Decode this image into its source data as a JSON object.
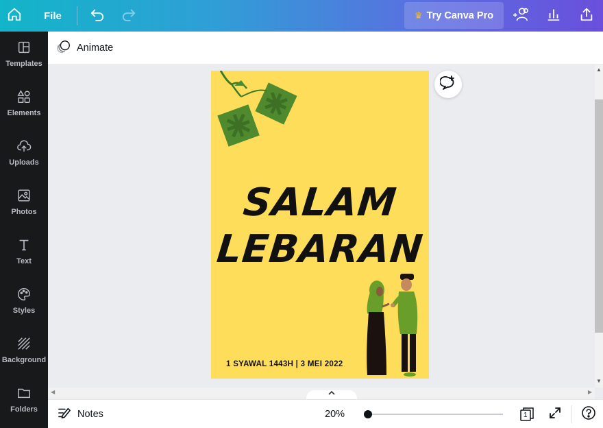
{
  "topbar": {
    "file_label": "File",
    "try_pro_label": "Try Canva Pro",
    "icons": [
      "home-icon",
      "undo-icon",
      "redo-icon",
      "crown-icon",
      "share-people-icon",
      "analytics-icon",
      "upload-share-icon"
    ]
  },
  "sidebar": {
    "items": [
      {
        "label": "Templates",
        "icon": "templates-icon"
      },
      {
        "label": "Elements",
        "icon": "elements-icon"
      },
      {
        "label": "Uploads",
        "icon": "uploads-icon"
      },
      {
        "label": "Photos",
        "icon": "photos-icon"
      },
      {
        "label": "Text",
        "icon": "text-icon"
      },
      {
        "label": "Styles",
        "icon": "styles-icon"
      },
      {
        "label": "Background",
        "icon": "background-icon"
      },
      {
        "label": "Folders",
        "icon": "folders-icon"
      }
    ]
  },
  "toolbar": {
    "animate_label": "Animate"
  },
  "design": {
    "title_line1": "SALAM",
    "title_line2": "LEBARAN",
    "date_text": "1 SYAWAL 1443H | 3 MEI 2022",
    "background_color": "#fedd5a",
    "ketupat_color": "#4f8a2f",
    "figure_green": "#6a9e2a"
  },
  "bottombar": {
    "notes_label": "Notes",
    "zoom_label": "20%",
    "zoom_level": 0.2,
    "page_count": "1"
  }
}
